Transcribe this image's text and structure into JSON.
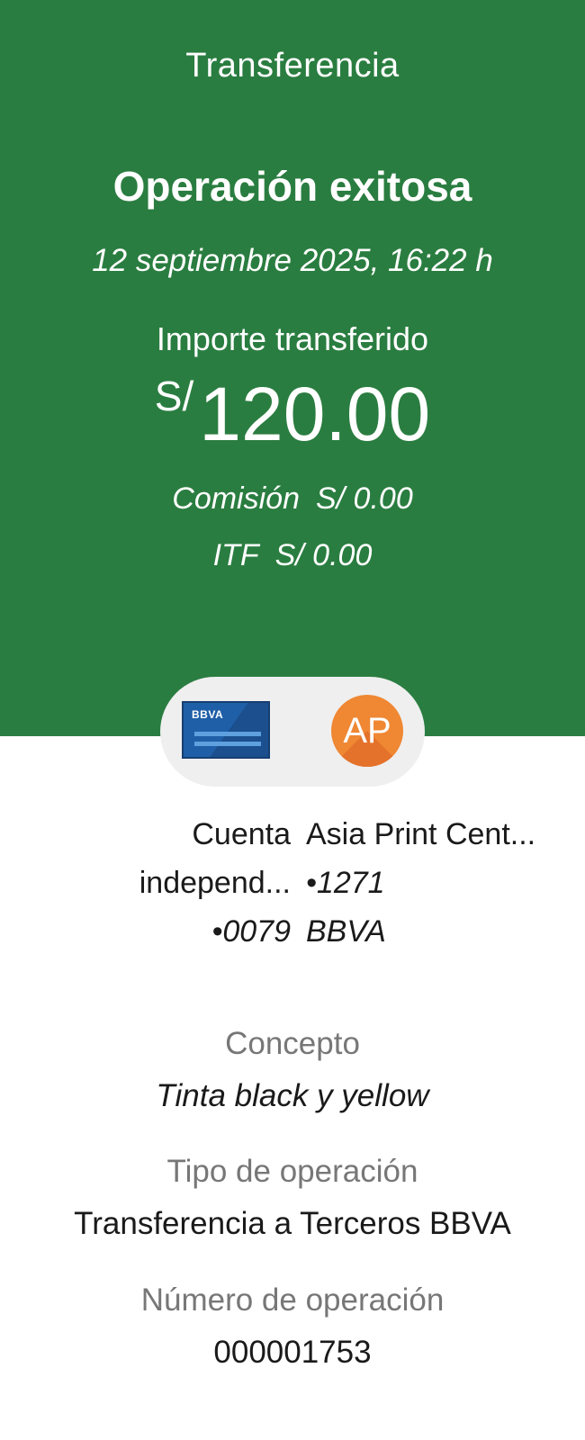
{
  "header": {
    "title": "Transferencia",
    "status": "Operación exitosa",
    "datetime": "12 septiembre 2025, 16:22 h",
    "amount_label": "Importe transferido",
    "currency": "S/",
    "amount": "120.00",
    "fees": [
      {
        "label": "Comisión",
        "value": "S/ 0.00"
      },
      {
        "label": "ITF",
        "value": "S/ 0.00"
      }
    ],
    "background_color": "#2a7d40"
  },
  "transfer": {
    "origin_icon": "bbva-card-icon",
    "origin_brand": "BBVA",
    "destination_initials": "AP",
    "destination_avatar_color": "#ef8733",
    "origin_lines": [
      "Cuenta",
      "independ...",
      "•0079"
    ],
    "destination_lines": [
      "Asia Print Cent...",
      "•1271",
      "BBVA"
    ]
  },
  "details": {
    "concept_label": "Concepto",
    "concept_value": "Tinta black y yellow",
    "operation_type_label": "Tipo de operación",
    "operation_type_value": "Transferencia a Terceros BBVA",
    "operation_number_label": "Número de operación",
    "operation_number_value": "000001753"
  }
}
